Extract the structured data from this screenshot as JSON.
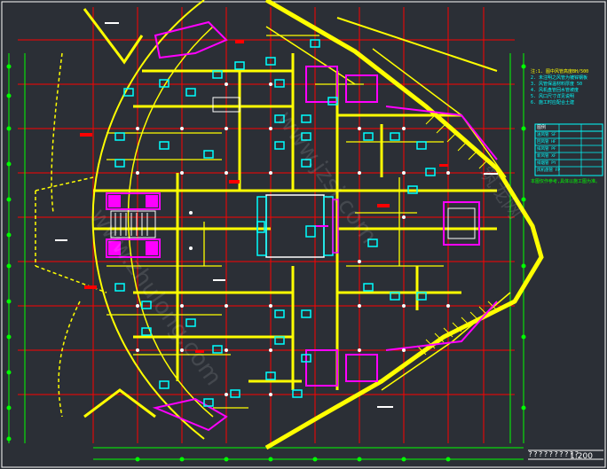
{
  "drawing": {
    "scale_label": "1:200",
    "title_block_marks": "??????????",
    "notes": [
      "注:1. 图中风管高度BH/500",
      "2. 未注明之风管为镀锌钢板",
      "3. 风管保温材料厚度 50",
      "4. 风机盘管回水管坡度",
      "5. 风口尺寸详见说明",
      "6. 施工时应配合土建"
    ],
    "legend_title": "图例",
    "legend_rows": [
      [
        "送风管",
        "SF",
        "—"
      ],
      [
        "回风管",
        "HF",
        "—"
      ],
      [
        "排风管",
        "PF",
        "—"
      ],
      [
        "新风管",
        "XF",
        "—"
      ],
      [
        "排烟管",
        "PY",
        "—"
      ],
      [
        "风机盘管",
        "FP",
        "—"
      ]
    ],
    "extra_note": "本图仅作参考,具体以施工图为准。",
    "watermarks": [
      "www.zhulong.com",
      "www.jzsj.com",
      "筑龙网"
    ]
  },
  "colors": {
    "background": "#2b2f36",
    "duct": "#ffff00",
    "grid": "#ff0000",
    "equipment": "#00ffff",
    "shafts": "#ff00ff",
    "dims": "#00ff00",
    "white": "#ffffff"
  }
}
